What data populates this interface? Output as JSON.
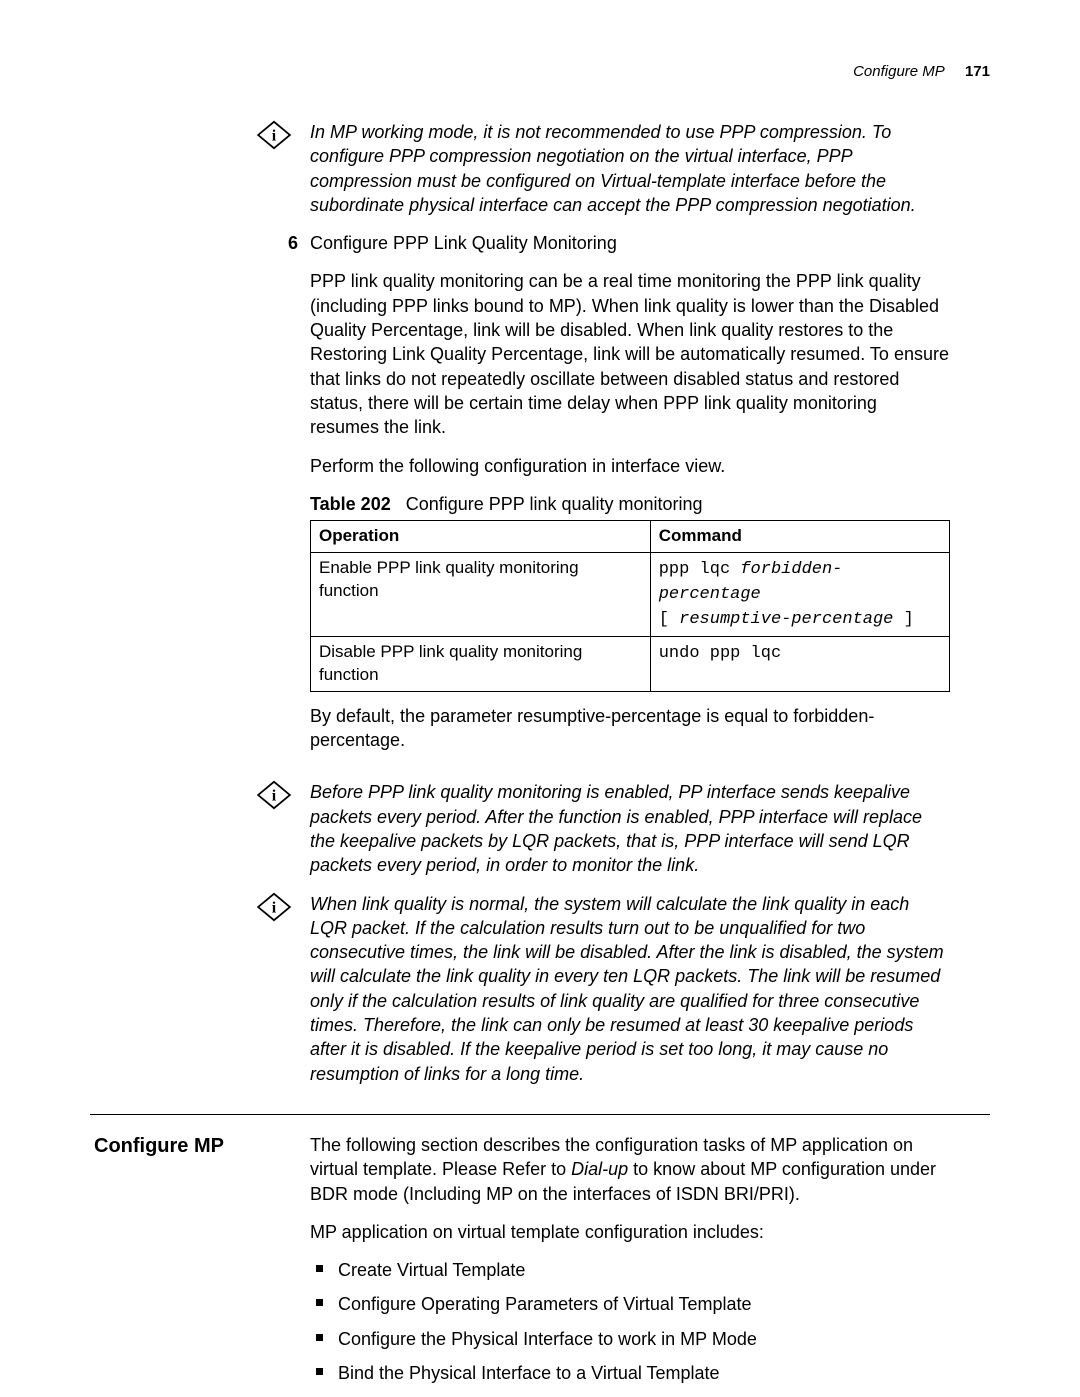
{
  "header": {
    "section": "Configure MP",
    "page_number": "171"
  },
  "note1": {
    "text": "In MP working mode, it is not recommended to use PPP compression. To configure PPP compression negotiation on the virtual interface, PPP compression must be configured on Virtual-template interface before the subordinate physical interface can accept the PPP compression negotiation."
  },
  "step6": {
    "number": "6",
    "title": "Configure PPP Link Quality Monitoring",
    "body": "PPP link quality monitoring can be a real time monitoring the PPP link quality (including PPP links bound to MP). When link quality is lower than the Disabled Quality Percentage, link will be disabled. When link quality restores to the Restoring Link Quality Percentage, link will be automatically resumed. To ensure that links do not repeatedly oscillate between disabled status and restored status, there will be certain time delay when PPP link quality monitoring resumes the link.",
    "perform_line": "Perform the following configuration in interface view."
  },
  "table": {
    "caption_label": "Table 202",
    "caption_text": "Configure PPP link quality monitoring",
    "columns": [
      "Operation",
      "Command"
    ],
    "rows": [
      {
        "op": "Enable PPP link quality monitoring function",
        "cmd_plain": "ppp lqc ",
        "cmd_arg1": "forbidden-percentage",
        "cmd_mid": "[ ",
        "cmd_arg2": "resumptive-percentage",
        "cmd_end": " ]"
      },
      {
        "op": "Disable PPP link quality monitoring function",
        "cmd_plain": "undo ppp lqc",
        "cmd_arg1": "",
        "cmd_mid": "",
        "cmd_arg2": "",
        "cmd_end": ""
      }
    ]
  },
  "after_table": "By default, the parameter resumptive-percentage is equal to forbidden-percentage.",
  "note2": {
    "text": "Before PPP link quality monitoring is enabled, PP interface sends keepalive packets every period. After the function is enabled, PPP interface will replace the keepalive packets by LQR packets, that is, PPP interface will send LQR packets every period, in order to monitor the link."
  },
  "note3": {
    "text": "When link quality is normal, the system will calculate the link quality in each LQR packet. If the calculation results turn out to be unqualified for two consecutive times, the link will be disabled. After the link is disabled, the system will calculate the link quality in every ten LQR packets. The link will be resumed only if the calculation results of link quality are qualified for three consecutive times. Therefore, the link can only be resumed at least 30 keepalive periods after it is disabled. If the keepalive period is set too long, it may cause no resumption of links for a long time."
  },
  "configure_mp": {
    "heading": "Configure MP",
    "intro_prefix": "The following section describes the configuration tasks of MP application on virtual template. Please Refer to ",
    "intro_em": "Dial-up",
    "intro_suffix": " to know about MP configuration under BDR mode (Including MP on the interfaces of ISDN BRI/PRI).",
    "includes_line": "MP application on virtual template configuration includes:",
    "bullets": [
      "Create Virtual Template",
      "Configure Operating Parameters of Virtual Template",
      "Configure the Physical Interface to work in MP Mode",
      "Bind the Physical Interface to a Virtual Template"
    ]
  }
}
